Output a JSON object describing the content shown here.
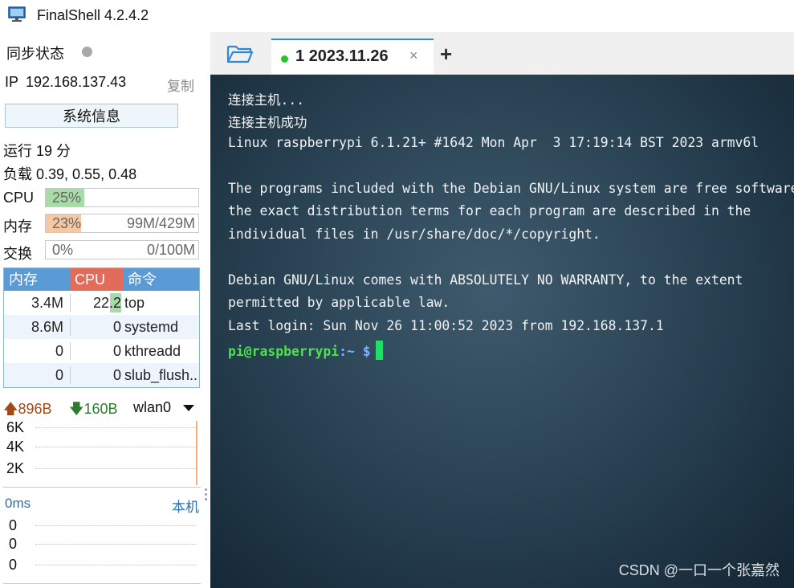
{
  "window": {
    "title": "FinalShell 4.2.4.2"
  },
  "sidebar": {
    "sync_label": "同步状态",
    "ip_label": "IP",
    "ip_value": "192.168.137.43",
    "copy_label": "复制",
    "sysinfo_button": "系统信息",
    "uptime": "运行 19 分",
    "load": "负载 0.39, 0.55, 0.48",
    "meters": [
      {
        "label": "CPU",
        "percent": "25%",
        "amount": "",
        "fill": 0.25,
        "color": "#a7dba7"
      },
      {
        "label": "内存",
        "percent": "23%",
        "amount": "99M/429M",
        "fill": 0.23,
        "color": "#f6c7a0"
      },
      {
        "label": "交换",
        "percent": "0%",
        "amount": "0/100M",
        "fill": 0.0,
        "color": "#cccccc"
      }
    ],
    "process_table": {
      "headers": [
        "内存",
        "CPU",
        "命令"
      ],
      "header_colors": [
        "#5b9bd5",
        "#e26b5a",
        "#5b9bd5"
      ],
      "rows": [
        {
          "mem": "3.4M",
          "cpu": "22.2",
          "cmd": "top"
        },
        {
          "mem": "8.6M",
          "cpu": "0",
          "cmd": "systemd"
        },
        {
          "mem": "0",
          "cpu": "0",
          "cmd": "kthreadd"
        },
        {
          "mem": "0",
          "cpu": "0",
          "cmd": "slub_flush.."
        }
      ]
    },
    "network": {
      "upload": "896B",
      "download": "160B",
      "interface": "wlan0",
      "scale": [
        "6K",
        "4K",
        "2K"
      ]
    },
    "ping": {
      "label": "0ms",
      "host": "本机",
      "values": [
        "0",
        "0",
        "0"
      ]
    }
  },
  "tabs": {
    "active": {
      "index": "1",
      "label": "2023.11.26",
      "status_color": "#2ec12e"
    },
    "close_glyph": "×",
    "add_glyph": "+"
  },
  "terminal": {
    "lines": [
      "连接主机...",
      "连接主机成功",
      "Linux raspberrypi 6.1.21+ #1642 Mon Apr  3 17:19:14 BST 2023 armv6l",
      "",
      "The programs included with the Debian GNU/Linux system are free software;",
      "the exact distribution terms for each program are described in the",
      "individual files in /usr/share/doc/*/copyright.",
      "",
      "Debian GNU/Linux comes with ABSOLUTELY NO WARRANTY, to the extent",
      "permitted by applicable law.",
      "Last login: Sun Nov 26 11:00:52 2023 from 192.168.137.1"
    ],
    "prompt_user": "pi@raspberrypi",
    "prompt_sep": ":",
    "prompt_path": "~ $",
    "watermark": "CSDN @一口一个张嘉然"
  }
}
